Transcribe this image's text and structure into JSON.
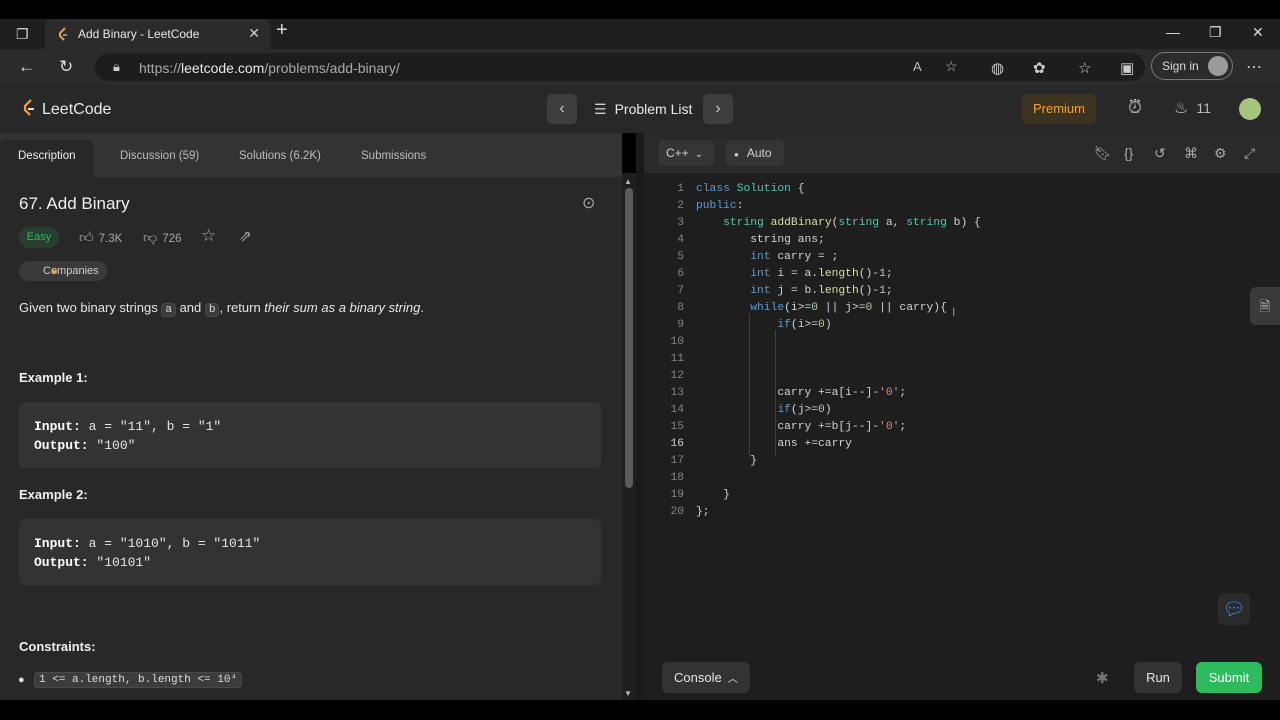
{
  "browser": {
    "tab_title": "Add Binary - LeetCode",
    "url_prefix": "https://",
    "url_domain": "leetcode.com",
    "url_path": "/problems/add-binary/",
    "sign_in": "Sign in"
  },
  "header": {
    "logo_text": "LeetCode",
    "problem_list": "Problem List",
    "premium": "Premium",
    "streak": "11"
  },
  "tabs": [
    "Description",
    "Discussion (59)",
    "Solutions (6.2K)",
    "Submissions"
  ],
  "problem": {
    "title": "67. Add Binary",
    "difficulty": "Easy",
    "likes": "7.3K",
    "dislikes": "726",
    "companies": "Companies",
    "desc_1": "Given two binary strings ",
    "desc_a": "a",
    "desc_2": " and ",
    "desc_b": "b",
    "desc_3": ", return ",
    "desc_em": "their sum as a binary string",
    "desc_4": ".",
    "example1_title": "Example 1:",
    "example1_input_label": "Input:",
    "example1_input": " a = \"11\", b = \"1\"",
    "example1_output_label": "Output:",
    "example1_output": " \"100\"",
    "example2_title": "Example 2:",
    "example2_input_label": "Input:",
    "example2_input": " a = \"1010\", b = \"1011\"",
    "example2_output_label": "Output:",
    "example2_output": " \"10101\"",
    "constraints_title": "Constraints:",
    "constraint_1": "1 <= a.length, b.length <= 10⁴"
  },
  "editor": {
    "language": "C++",
    "mode": "Auto",
    "console": "Console",
    "run": "Run",
    "submit": "Submit"
  }
}
